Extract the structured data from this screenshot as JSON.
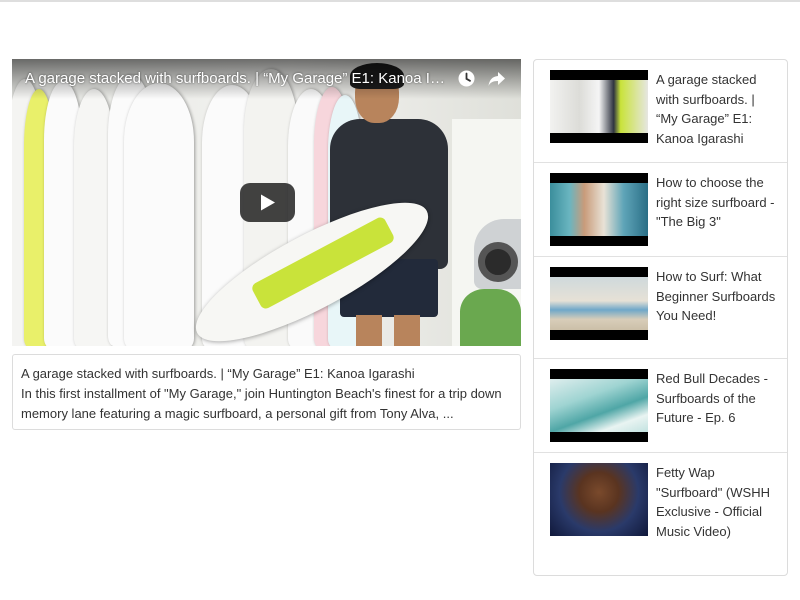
{
  "player": {
    "title": "A garage stacked with surfboards. | “My Garage” E1: Kanoa Igar…",
    "icons": [
      "watch-later-icon",
      "share-icon",
      "play-icon"
    ]
  },
  "description": {
    "title": "A garage stacked with surfboards. | “My Garage” E1: Kanoa Igarashi",
    "text": "In this first installment of \"My Garage,\" join Huntington Beach's finest for a trip down memory lane featuring a magic surfboard, a personal gift from Tony Alva, ..."
  },
  "related": {
    "items": [
      {
        "title": "A garage stacked with surfboards. | “My Garage” E1: Kanoa Igarashi"
      },
      {
        "title": "How to choose the right size surfboard - \"The Big 3\""
      },
      {
        "title": "How to Surf: What Beginner Surfboards You Need!"
      },
      {
        "title": "Red Bull Decades - Surfboards of the Future - Ep. 6"
      },
      {
        "title": "Fetty Wap \"Surfboard\" (WSHH Exclusive - Official Music Video)"
      }
    ]
  },
  "colors": {
    "border": "#dcdcdc",
    "text": "#333333",
    "overlay_text": "#ffffff"
  }
}
